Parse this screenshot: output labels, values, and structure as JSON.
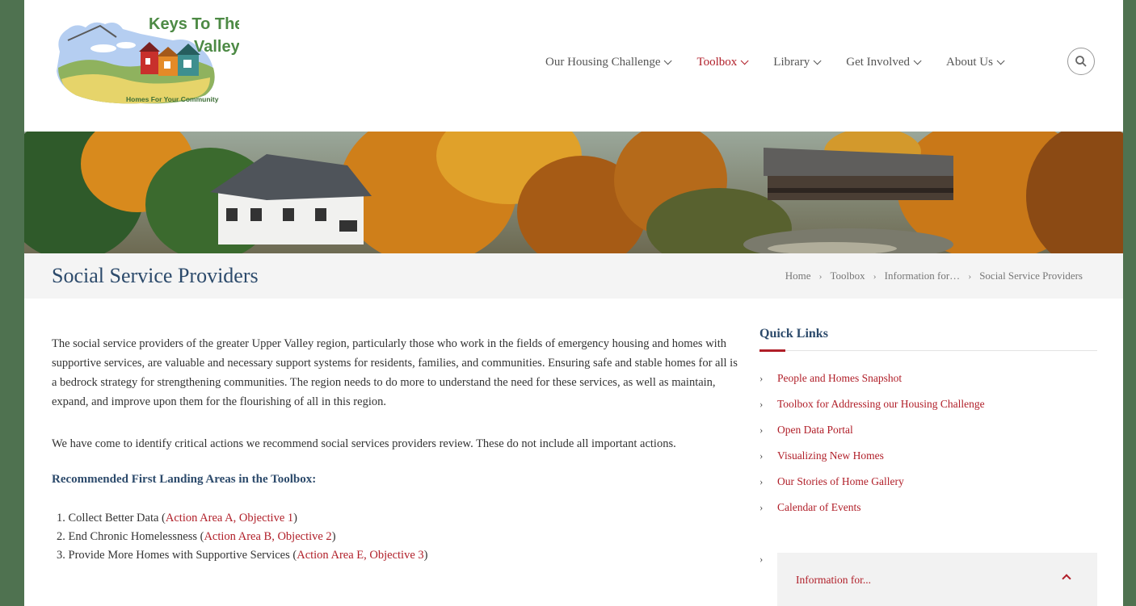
{
  "header": {
    "logo": {
      "title_line1": "Keys To The",
      "title_line2": "Valley",
      "tagline": "Homes For Your Community"
    },
    "nav": [
      {
        "label": "Our Housing Challenge",
        "active": false
      },
      {
        "label": "Toolbox",
        "active": true
      },
      {
        "label": "Library",
        "active": false
      },
      {
        "label": "Get Involved",
        "active": false
      },
      {
        "label": "About Us",
        "active": false
      }
    ],
    "search_icon": "search-icon"
  },
  "title_bar": {
    "title": "Social Service Providers",
    "breadcrumb": [
      "Home",
      "Toolbox",
      "Information for…",
      "Social Service Providers"
    ]
  },
  "main": {
    "intro": "The social service providers of the greater Upper Valley region, particularly those who work in the fields of emergency housing and homes with supportive services, are valuable and necessary support systems for residents, families, and communities. Ensuring safe and stable homes for all is a bedrock strategy for strengthening communities. The region needs to do more to understand the need for these services, as well as maintain, expand, and improve upon them for the flourishing of all in this region.",
    "actions_text": "We have come to identify critical actions we recommend social services providers review. These do not include all important actions.",
    "rec_heading": "Recommended First Landing Areas in the Toolbox:",
    "rec_items": [
      {
        "num": "1.",
        "text": "Collect Better Data (",
        "link": "Action Area A, Objective 1",
        "close": ")"
      },
      {
        "num": "2.",
        "text": "End Chronic Homelessness (",
        "link": "Action Area B, Objective 2",
        "close": ")"
      },
      {
        "num": "3.",
        "text": "Provide More Homes with Supportive Services (",
        "link": "Action Area E, Objective 3",
        "close": ")"
      }
    ]
  },
  "sidebar": {
    "quick_heading": "Quick Links",
    "quick_links": [
      "People and Homes Snapshot",
      "Toolbox for Addressing our Housing Challenge",
      "Open Data Portal",
      "Visualizing New Homes",
      "Our Stories of Home Gallery",
      "Calendar of Events"
    ],
    "info_panel_label": "Information for..."
  },
  "colors": {
    "accent": "#b01e28",
    "heading_blue": "#2c4a6b",
    "frame_green": "#4f7250"
  }
}
